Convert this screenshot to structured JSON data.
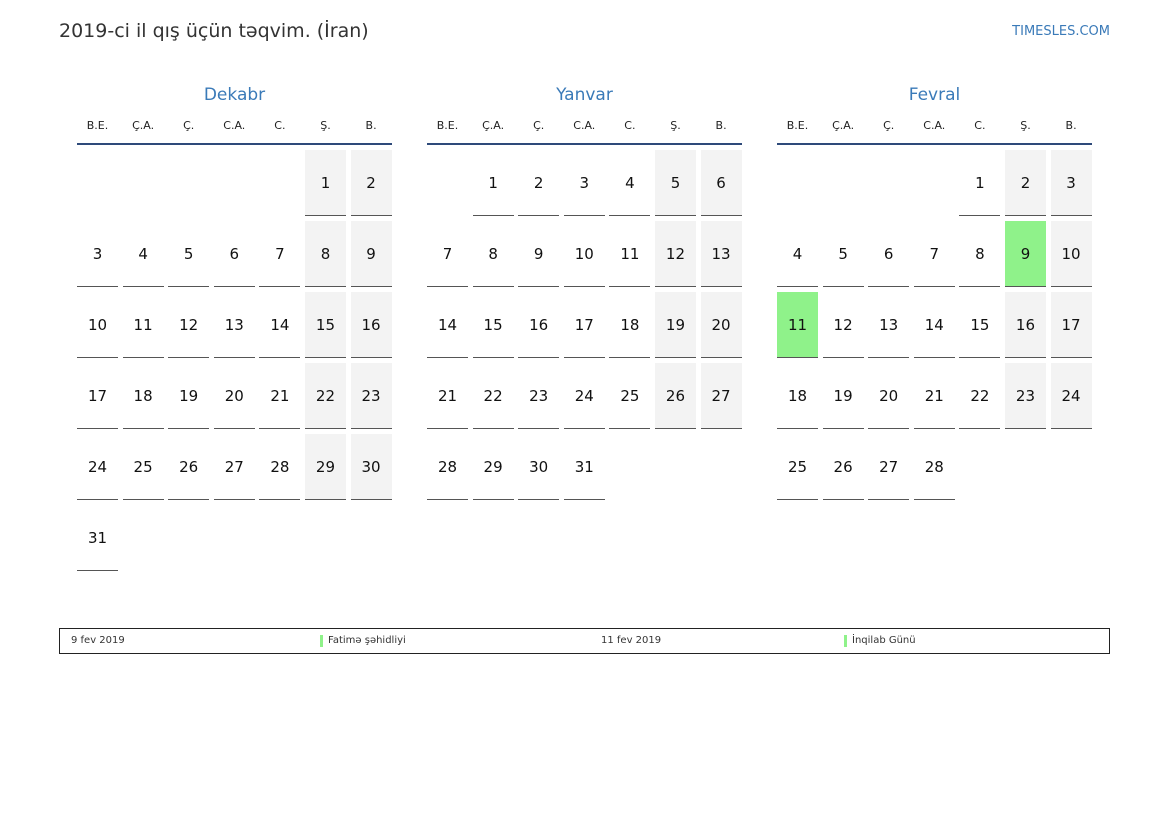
{
  "header": {
    "title": "2019-ci il qış üçün təqvim. (İran)",
    "brand": "TIMESLES.COM"
  },
  "weekdays": [
    "B.E.",
    "Ç.A.",
    "Ç.",
    "C.A.",
    "C.",
    "Ş.",
    "B."
  ],
  "months": [
    {
      "name": "Dekabr",
      "offset": 5,
      "days": 31,
      "weekend": [
        1,
        2,
        8,
        9,
        15,
        16,
        22,
        23,
        29,
        30
      ],
      "holidays": []
    },
    {
      "name": "Yanvar",
      "offset": 1,
      "days": 31,
      "weekend": [
        5,
        6,
        12,
        13,
        19,
        20,
        26,
        27
      ],
      "holidays": []
    },
    {
      "name": "Fevral",
      "offset": 4,
      "days": 28,
      "weekend": [
        2,
        3,
        9,
        10,
        16,
        17,
        23,
        24
      ],
      "holidays": [
        9,
        11
      ]
    }
  ],
  "legend": [
    {
      "date": "9 fev 2019",
      "name": "Fatimə şəhidliyi"
    },
    {
      "date": "11 fev 2019",
      "name": "İnqilab Günü"
    }
  ],
  "colors": {
    "accent": "#3a7ab8",
    "holiday": "#8ff28a",
    "weekend": "#f3f3f3",
    "rule": "#2e4a7a"
  }
}
